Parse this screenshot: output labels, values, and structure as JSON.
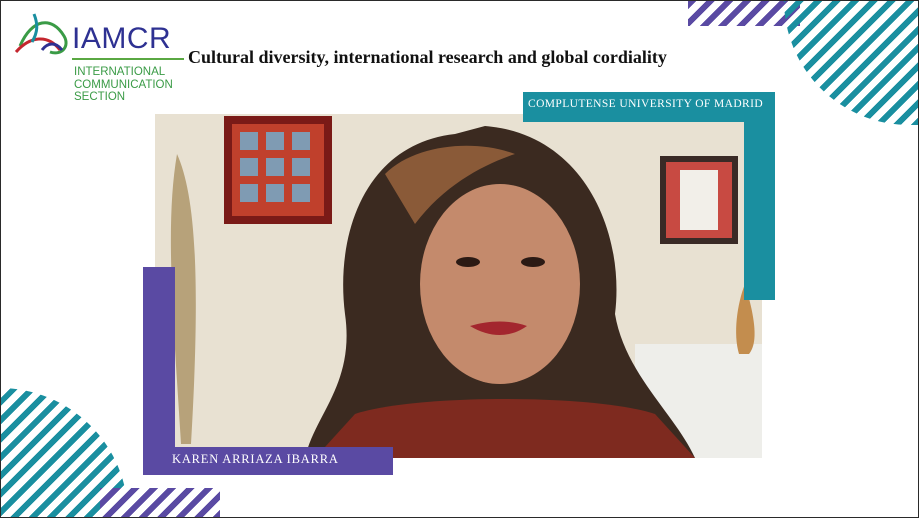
{
  "logo": {
    "name": "IAMCR",
    "subtitle_lines": [
      "INTERNATIONAL",
      "COMMUNICATION",
      "SECTION"
    ]
  },
  "title": "Cultural diversity, international research and global cordiality",
  "speaker": {
    "name": "KAREN ARRIAZA IBARRA",
    "affiliation": "COMPLUTENSE UNIVERSITY OF MADRID"
  },
  "colors": {
    "purple": "#5a4aa3",
    "teal": "#1a8fa0",
    "logo_blue": "#2e3192",
    "logo_green": "#3a9b46"
  }
}
